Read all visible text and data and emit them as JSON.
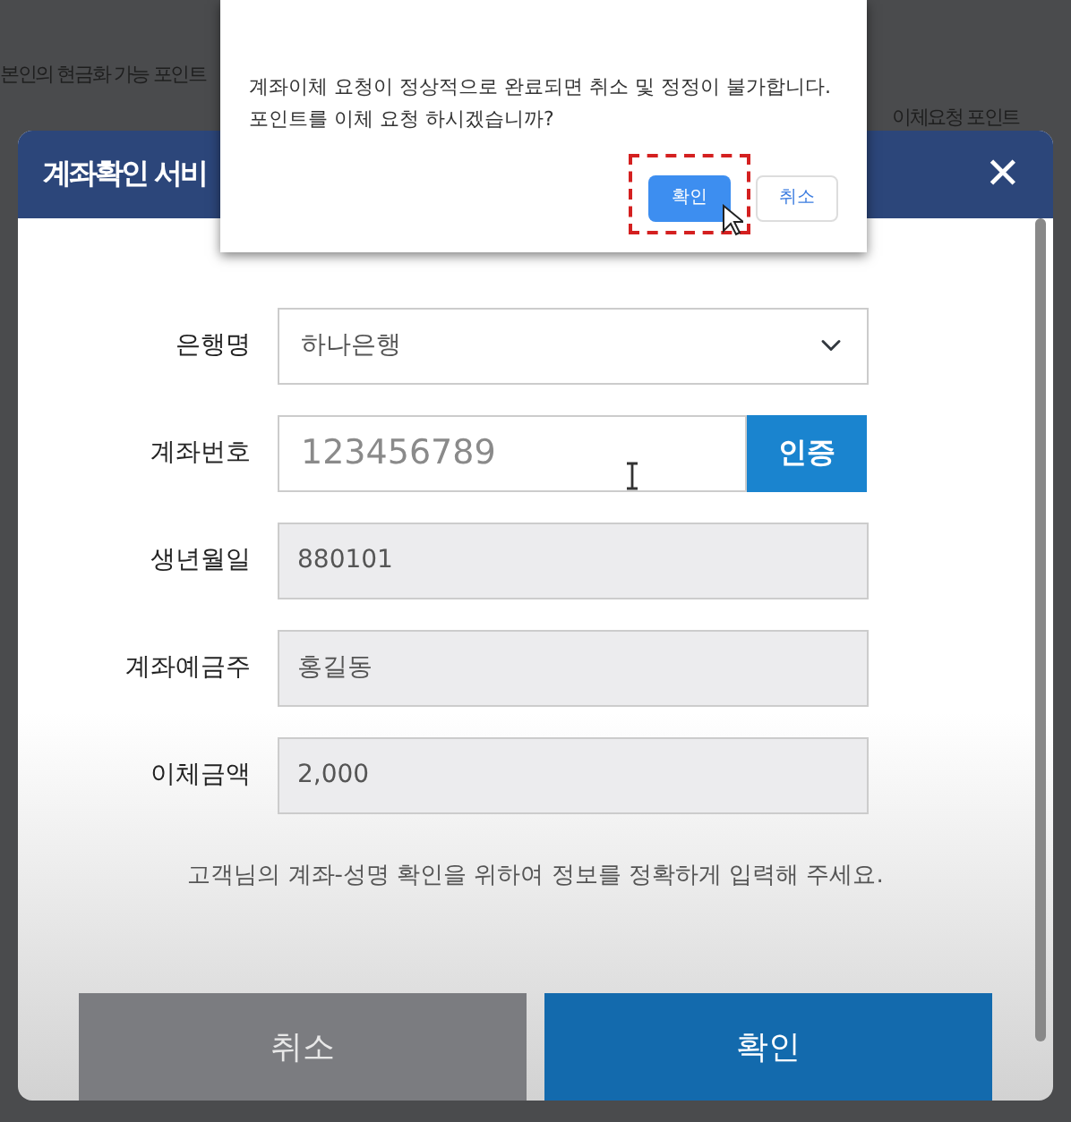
{
  "background_page": {
    "lines": [
      "본인의 현금화 가능 포인트",
      "이체요청 포인트"
    ]
  },
  "modal": {
    "title": "계좌확인 서비",
    "close": "✕",
    "fields": [
      {
        "kind": "select",
        "label": "은행명",
        "value": "하나은행"
      },
      {
        "kind": "input",
        "label": "계좌번호",
        "placeholder": "123456789",
        "action": "인증"
      },
      {
        "kind": "readonly",
        "label": "생년월일",
        "value": "880101"
      },
      {
        "kind": "readonly",
        "label": "계좌예금주",
        "value": "홍길동"
      },
      {
        "kind": "readonly",
        "label": "이체금액",
        "value": "2,000"
      }
    ],
    "note": "고객님의 계좌-성명 확인을 위하여 정보를 정확하게 입력해 주세요.",
    "buttons": [
      {
        "label": "취소",
        "kind": "secondary"
      },
      {
        "label": "확인",
        "kind": "primary"
      }
    ]
  },
  "alert": {
    "lines": [
      "계좌이체 요청이 정상적으로 완료되면 취소 및 정정이 불가합니다.",
      "포인트를 이체 요청 하시겠습니까?"
    ],
    "buttons": [
      {
        "label": "확인",
        "kind": "primary",
        "highlighted": true
      },
      {
        "label": "취소",
        "kind": "secondary",
        "highlighted": false
      }
    ]
  }
}
